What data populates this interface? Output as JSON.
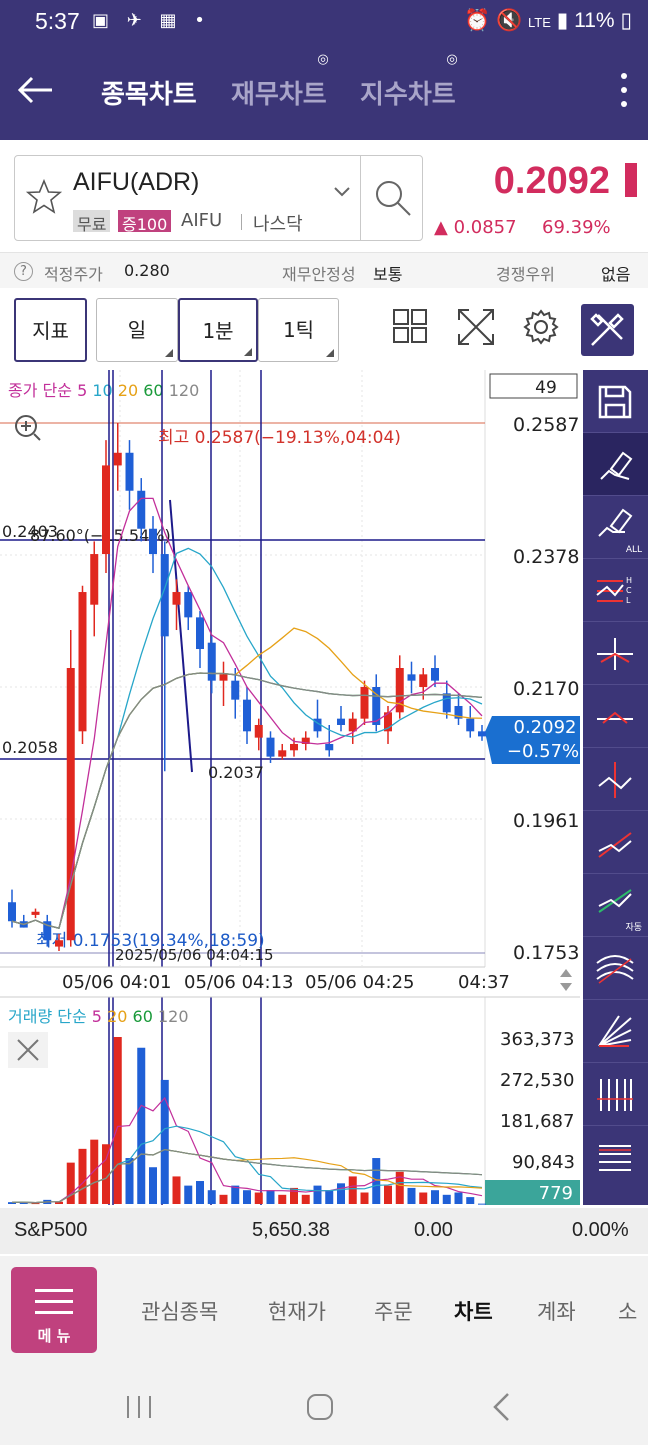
{
  "status": {
    "time": "5:37",
    "battery": "11%",
    "network": "LTE"
  },
  "appbar": {
    "tabs": [
      {
        "label": "종목차트",
        "active": true
      },
      {
        "label": "재무차트",
        "active": false
      },
      {
        "label": "지수차트",
        "active": false
      }
    ]
  },
  "stock": {
    "name": "AIFU(ADR)",
    "badge_free": "무료",
    "badge_margin": "증100",
    "ticker": "AIFU",
    "market": "나스닥",
    "price": "0.2092",
    "change": "▲ 0.0857",
    "change_pct": "69.39%"
  },
  "info": {
    "fair_label": "적정주가",
    "fair_value": "0.280",
    "fin_label": "재무안정성",
    "fin_value": "보통",
    "comp_label": "경쟁우위",
    "comp_value": "없음"
  },
  "toolbar": {
    "indicator": "지표",
    "day": "일",
    "min1": "1분",
    "tick1": "1틱"
  },
  "chart": {
    "price_legend": {
      "title": "종가 단순",
      "p5": "5",
      "p10": "10",
      "p20": "20",
      "p60": "60",
      "p120": "120"
    },
    "count_box": "49",
    "y_ticks": [
      "0.2587",
      "0.2378",
      "0.2170",
      "0.1961",
      "0.1753"
    ],
    "high_label": "최고 0.2587(−19.13%,04:04)",
    "low_label": "최저 0.1753(19.34%,18:59)",
    "angle_label": "87.60°(−15.54%)",
    "hline1": "0.2403",
    "hline2": "0.2058",
    "point_label": "0.2037",
    "current_price": "0.2092",
    "current_pct": "−0.57%",
    "overlap_label": "2025/05/06 04:04:15",
    "x_ticks": [
      "05/06 04:01",
      "05/06 04:13",
      "05/06 04:25",
      "04:37"
    ],
    "vol_legend": {
      "title": "거래량 단순",
      "p5": "5",
      "p20": "20",
      "p60": "60",
      "p120": "120"
    },
    "vol_ticks": [
      "363,373",
      "272,530",
      "181,687",
      "90,843"
    ],
    "vol_current": "779"
  },
  "chart_data": {
    "type": "candlestick",
    "y_range": [
      0.1753,
      0.2587
    ],
    "candles": [
      [
        0.183,
        0.185,
        0.179,
        0.18
      ],
      [
        0.18,
        0.181,
        0.179,
        0.179
      ],
      [
        0.181,
        0.182,
        0.1805,
        0.1815
      ],
      [
        0.18,
        0.181,
        0.176,
        0.177
      ],
      [
        0.176,
        0.178,
        0.1753,
        0.177
      ],
      [
        0.177,
        0.226,
        0.176,
        0.22
      ],
      [
        0.21,
        0.233,
        0.208,
        0.232
      ],
      [
        0.23,
        0.24,
        0.225,
        0.238
      ],
      [
        0.238,
        0.256,
        0.235,
        0.252
      ],
      [
        0.252,
        0.2587,
        0.248,
        0.254
      ],
      [
        0.254,
        0.256,
        0.245,
        0.248
      ],
      [
        0.248,
        0.25,
        0.24,
        0.242
      ],
      [
        0.242,
        0.244,
        0.235,
        0.238
      ],
      [
        0.238,
        0.24,
        0.2037,
        0.225
      ],
      [
        0.23,
        0.234,
        0.226,
        0.232
      ],
      [
        0.232,
        0.233,
        0.226,
        0.228
      ],
      [
        0.228,
        0.229,
        0.22,
        0.223
      ],
      [
        0.224,
        0.225,
        0.216,
        0.218
      ],
      [
        0.218,
        0.221,
        0.214,
        0.219
      ],
      [
        0.218,
        0.22,
        0.212,
        0.215
      ],
      [
        0.215,
        0.217,
        0.208,
        0.21
      ],
      [
        0.209,
        0.212,
        0.207,
        0.211
      ],
      [
        0.209,
        0.21,
        0.205,
        0.206
      ],
      [
        0.206,
        0.208,
        0.2055,
        0.207
      ],
      [
        0.207,
        0.209,
        0.206,
        0.208
      ],
      [
        0.208,
        0.21,
        0.207,
        0.209
      ],
      [
        0.212,
        0.215,
        0.209,
        0.21
      ],
      [
        0.208,
        0.211,
        0.206,
        0.207
      ],
      [
        0.212,
        0.214,
        0.21,
        0.211
      ],
      [
        0.21,
        0.213,
        0.208,
        0.212
      ],
      [
        0.212,
        0.218,
        0.211,
        0.217
      ],
      [
        0.217,
        0.219,
        0.21,
        0.211
      ],
      [
        0.21,
        0.214,
        0.208,
        0.213
      ],
      [
        0.213,
        0.222,
        0.212,
        0.22
      ],
      [
        0.219,
        0.221,
        0.216,
        0.218
      ],
      [
        0.217,
        0.22,
        0.215,
        0.219
      ],
      [
        0.22,
        0.222,
        0.217,
        0.218
      ],
      [
        0.216,
        0.218,
        0.212,
        0.213
      ],
      [
        0.214,
        0.216,
        0.211,
        0.212
      ],
      [
        0.212,
        0.214,
        0.209,
        0.21
      ],
      [
        0.21,
        0.211,
        0.2085,
        0.2092
      ]
    ],
    "volumes": [
      4000,
      3000,
      2000,
      9000,
      5000,
      90000,
      120000,
      140000,
      130000,
      363373,
      100000,
      340000,
      80000,
      270000,
      60000,
      40000,
      50000,
      30000,
      20000,
      40000,
      30000,
      25000,
      30000,
      20000,
      35000,
      20000,
      40000,
      30000,
      45000,
      60000,
      25000,
      100000,
      40000,
      70000,
      35000,
      25000,
      30000,
      20000,
      25000,
      15000,
      779
    ]
  }
}
